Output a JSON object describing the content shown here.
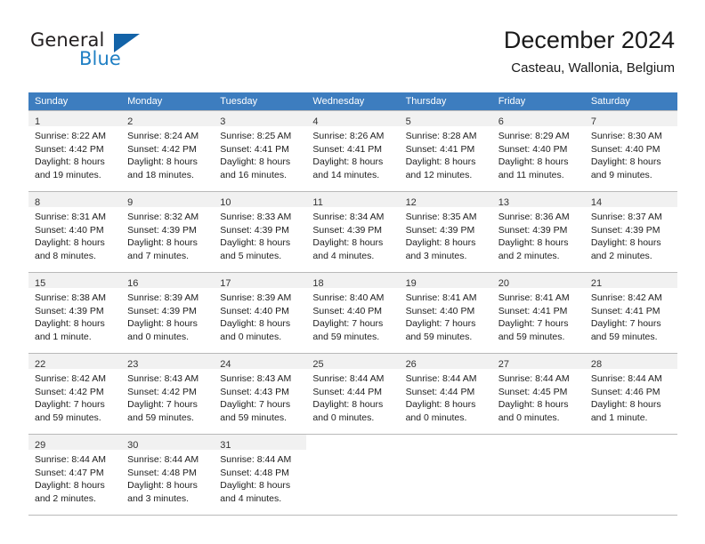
{
  "brand": {
    "name_top": "General",
    "name_bottom": "Blue",
    "accent_color": "#1f7fc4",
    "triangle_color": "#1363a8"
  },
  "header": {
    "title": "December 2024",
    "subtitle": "Casteau, Wallonia, Belgium"
  },
  "calendar": {
    "header_bg": "#3d7dbf",
    "header_text_color": "#ffffff",
    "daynum_band_bg": "#f1f1f1",
    "weekday_headers": [
      "Sunday",
      "Monday",
      "Tuesday",
      "Wednesday",
      "Thursday",
      "Friday",
      "Saturday"
    ],
    "weeks": [
      [
        {
          "day": "1",
          "sunrise": "Sunrise: 8:22 AM",
          "sunset": "Sunset: 4:42 PM",
          "daylight_line1": "Daylight: 8 hours",
          "daylight_line2": "and 19 minutes."
        },
        {
          "day": "2",
          "sunrise": "Sunrise: 8:24 AM",
          "sunset": "Sunset: 4:42 PM",
          "daylight_line1": "Daylight: 8 hours",
          "daylight_line2": "and 18 minutes."
        },
        {
          "day": "3",
          "sunrise": "Sunrise: 8:25 AM",
          "sunset": "Sunset: 4:41 PM",
          "daylight_line1": "Daylight: 8 hours",
          "daylight_line2": "and 16 minutes."
        },
        {
          "day": "4",
          "sunrise": "Sunrise: 8:26 AM",
          "sunset": "Sunset: 4:41 PM",
          "daylight_line1": "Daylight: 8 hours",
          "daylight_line2": "and 14 minutes."
        },
        {
          "day": "5",
          "sunrise": "Sunrise: 8:28 AM",
          "sunset": "Sunset: 4:41 PM",
          "daylight_line1": "Daylight: 8 hours",
          "daylight_line2": "and 12 minutes."
        },
        {
          "day": "6",
          "sunrise": "Sunrise: 8:29 AM",
          "sunset": "Sunset: 4:40 PM",
          "daylight_line1": "Daylight: 8 hours",
          "daylight_line2": "and 11 minutes."
        },
        {
          "day": "7",
          "sunrise": "Sunrise: 8:30 AM",
          "sunset": "Sunset: 4:40 PM",
          "daylight_line1": "Daylight: 8 hours",
          "daylight_line2": "and 9 minutes."
        }
      ],
      [
        {
          "day": "8",
          "sunrise": "Sunrise: 8:31 AM",
          "sunset": "Sunset: 4:40 PM",
          "daylight_line1": "Daylight: 8 hours",
          "daylight_line2": "and 8 minutes."
        },
        {
          "day": "9",
          "sunrise": "Sunrise: 8:32 AM",
          "sunset": "Sunset: 4:39 PM",
          "daylight_line1": "Daylight: 8 hours",
          "daylight_line2": "and 7 minutes."
        },
        {
          "day": "10",
          "sunrise": "Sunrise: 8:33 AM",
          "sunset": "Sunset: 4:39 PM",
          "daylight_line1": "Daylight: 8 hours",
          "daylight_line2": "and 5 minutes."
        },
        {
          "day": "11",
          "sunrise": "Sunrise: 8:34 AM",
          "sunset": "Sunset: 4:39 PM",
          "daylight_line1": "Daylight: 8 hours",
          "daylight_line2": "and 4 minutes."
        },
        {
          "day": "12",
          "sunrise": "Sunrise: 8:35 AM",
          "sunset": "Sunset: 4:39 PM",
          "daylight_line1": "Daylight: 8 hours",
          "daylight_line2": "and 3 minutes."
        },
        {
          "day": "13",
          "sunrise": "Sunrise: 8:36 AM",
          "sunset": "Sunset: 4:39 PM",
          "daylight_line1": "Daylight: 8 hours",
          "daylight_line2": "and 2 minutes."
        },
        {
          "day": "14",
          "sunrise": "Sunrise: 8:37 AM",
          "sunset": "Sunset: 4:39 PM",
          "daylight_line1": "Daylight: 8 hours",
          "daylight_line2": "and 2 minutes."
        }
      ],
      [
        {
          "day": "15",
          "sunrise": "Sunrise: 8:38 AM",
          "sunset": "Sunset: 4:39 PM",
          "daylight_line1": "Daylight: 8 hours",
          "daylight_line2": "and 1 minute."
        },
        {
          "day": "16",
          "sunrise": "Sunrise: 8:39 AM",
          "sunset": "Sunset: 4:39 PM",
          "daylight_line1": "Daylight: 8 hours",
          "daylight_line2": "and 0 minutes."
        },
        {
          "day": "17",
          "sunrise": "Sunrise: 8:39 AM",
          "sunset": "Sunset: 4:40 PM",
          "daylight_line1": "Daylight: 8 hours",
          "daylight_line2": "and 0 minutes."
        },
        {
          "day": "18",
          "sunrise": "Sunrise: 8:40 AM",
          "sunset": "Sunset: 4:40 PM",
          "daylight_line1": "Daylight: 7 hours",
          "daylight_line2": "and 59 minutes."
        },
        {
          "day": "19",
          "sunrise": "Sunrise: 8:41 AM",
          "sunset": "Sunset: 4:40 PM",
          "daylight_line1": "Daylight: 7 hours",
          "daylight_line2": "and 59 minutes."
        },
        {
          "day": "20",
          "sunrise": "Sunrise: 8:41 AM",
          "sunset": "Sunset: 4:41 PM",
          "daylight_line1": "Daylight: 7 hours",
          "daylight_line2": "and 59 minutes."
        },
        {
          "day": "21",
          "sunrise": "Sunrise: 8:42 AM",
          "sunset": "Sunset: 4:41 PM",
          "daylight_line1": "Daylight: 7 hours",
          "daylight_line2": "and 59 minutes."
        }
      ],
      [
        {
          "day": "22",
          "sunrise": "Sunrise: 8:42 AM",
          "sunset": "Sunset: 4:42 PM",
          "daylight_line1": "Daylight: 7 hours",
          "daylight_line2": "and 59 minutes."
        },
        {
          "day": "23",
          "sunrise": "Sunrise: 8:43 AM",
          "sunset": "Sunset: 4:42 PM",
          "daylight_line1": "Daylight: 7 hours",
          "daylight_line2": "and 59 minutes."
        },
        {
          "day": "24",
          "sunrise": "Sunrise: 8:43 AM",
          "sunset": "Sunset: 4:43 PM",
          "daylight_line1": "Daylight: 7 hours",
          "daylight_line2": "and 59 minutes."
        },
        {
          "day": "25",
          "sunrise": "Sunrise: 8:44 AM",
          "sunset": "Sunset: 4:44 PM",
          "daylight_line1": "Daylight: 8 hours",
          "daylight_line2": "and 0 minutes."
        },
        {
          "day": "26",
          "sunrise": "Sunrise: 8:44 AM",
          "sunset": "Sunset: 4:44 PM",
          "daylight_line1": "Daylight: 8 hours",
          "daylight_line2": "and 0 minutes."
        },
        {
          "day": "27",
          "sunrise": "Sunrise: 8:44 AM",
          "sunset": "Sunset: 4:45 PM",
          "daylight_line1": "Daylight: 8 hours",
          "daylight_line2": "and 0 minutes."
        },
        {
          "day": "28",
          "sunrise": "Sunrise: 8:44 AM",
          "sunset": "Sunset: 4:46 PM",
          "daylight_line1": "Daylight: 8 hours",
          "daylight_line2": "and 1 minute."
        }
      ],
      [
        {
          "day": "29",
          "sunrise": "Sunrise: 8:44 AM",
          "sunset": "Sunset: 4:47 PM",
          "daylight_line1": "Daylight: 8 hours",
          "daylight_line2": "and 2 minutes."
        },
        {
          "day": "30",
          "sunrise": "Sunrise: 8:44 AM",
          "sunset": "Sunset: 4:48 PM",
          "daylight_line1": "Daylight: 8 hours",
          "daylight_line2": "and 3 minutes."
        },
        {
          "day": "31",
          "sunrise": "Sunrise: 8:44 AM",
          "sunset": "Sunset: 4:48 PM",
          "daylight_line1": "Daylight: 8 hours",
          "daylight_line2": "and 4 minutes."
        },
        {
          "day": "",
          "sunrise": "",
          "sunset": "",
          "daylight_line1": "",
          "daylight_line2": ""
        },
        {
          "day": "",
          "sunrise": "",
          "sunset": "",
          "daylight_line1": "",
          "daylight_line2": ""
        },
        {
          "day": "",
          "sunrise": "",
          "sunset": "",
          "daylight_line1": "",
          "daylight_line2": ""
        },
        {
          "day": "",
          "sunrise": "",
          "sunset": "",
          "daylight_line1": "",
          "daylight_line2": ""
        }
      ]
    ]
  }
}
